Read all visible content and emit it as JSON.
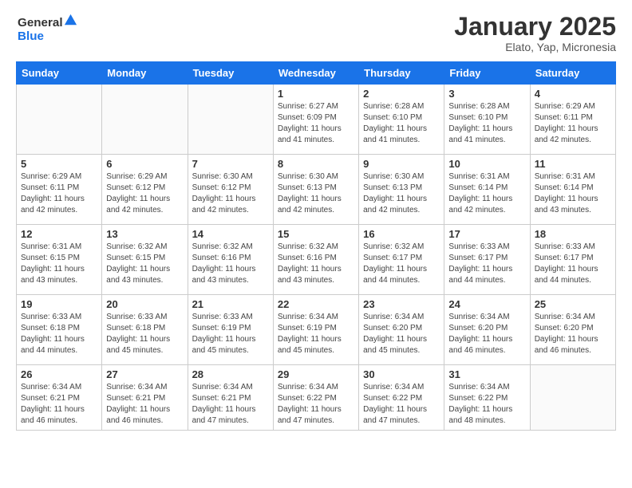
{
  "header": {
    "logo_general": "General",
    "logo_blue": "Blue",
    "month": "January 2025",
    "location": "Elato, Yap, Micronesia"
  },
  "weekdays": [
    "Sunday",
    "Monday",
    "Tuesday",
    "Wednesday",
    "Thursday",
    "Friday",
    "Saturday"
  ],
  "weeks": [
    [
      {
        "day": "",
        "info": ""
      },
      {
        "day": "",
        "info": ""
      },
      {
        "day": "",
        "info": ""
      },
      {
        "day": "1",
        "info": "Sunrise: 6:27 AM\nSunset: 6:09 PM\nDaylight: 11 hours and 41 minutes."
      },
      {
        "day": "2",
        "info": "Sunrise: 6:28 AM\nSunset: 6:10 PM\nDaylight: 11 hours and 41 minutes."
      },
      {
        "day": "3",
        "info": "Sunrise: 6:28 AM\nSunset: 6:10 PM\nDaylight: 11 hours and 41 minutes."
      },
      {
        "day": "4",
        "info": "Sunrise: 6:29 AM\nSunset: 6:11 PM\nDaylight: 11 hours and 42 minutes."
      }
    ],
    [
      {
        "day": "5",
        "info": "Sunrise: 6:29 AM\nSunset: 6:11 PM\nDaylight: 11 hours and 42 minutes."
      },
      {
        "day": "6",
        "info": "Sunrise: 6:29 AM\nSunset: 6:12 PM\nDaylight: 11 hours and 42 minutes."
      },
      {
        "day": "7",
        "info": "Sunrise: 6:30 AM\nSunset: 6:12 PM\nDaylight: 11 hours and 42 minutes."
      },
      {
        "day": "8",
        "info": "Sunrise: 6:30 AM\nSunset: 6:13 PM\nDaylight: 11 hours and 42 minutes."
      },
      {
        "day": "9",
        "info": "Sunrise: 6:30 AM\nSunset: 6:13 PM\nDaylight: 11 hours and 42 minutes."
      },
      {
        "day": "10",
        "info": "Sunrise: 6:31 AM\nSunset: 6:14 PM\nDaylight: 11 hours and 42 minutes."
      },
      {
        "day": "11",
        "info": "Sunrise: 6:31 AM\nSunset: 6:14 PM\nDaylight: 11 hours and 43 minutes."
      }
    ],
    [
      {
        "day": "12",
        "info": "Sunrise: 6:31 AM\nSunset: 6:15 PM\nDaylight: 11 hours and 43 minutes."
      },
      {
        "day": "13",
        "info": "Sunrise: 6:32 AM\nSunset: 6:15 PM\nDaylight: 11 hours and 43 minutes."
      },
      {
        "day": "14",
        "info": "Sunrise: 6:32 AM\nSunset: 6:16 PM\nDaylight: 11 hours and 43 minutes."
      },
      {
        "day": "15",
        "info": "Sunrise: 6:32 AM\nSunset: 6:16 PM\nDaylight: 11 hours and 43 minutes."
      },
      {
        "day": "16",
        "info": "Sunrise: 6:32 AM\nSunset: 6:17 PM\nDaylight: 11 hours and 44 minutes."
      },
      {
        "day": "17",
        "info": "Sunrise: 6:33 AM\nSunset: 6:17 PM\nDaylight: 11 hours and 44 minutes."
      },
      {
        "day": "18",
        "info": "Sunrise: 6:33 AM\nSunset: 6:17 PM\nDaylight: 11 hours and 44 minutes."
      }
    ],
    [
      {
        "day": "19",
        "info": "Sunrise: 6:33 AM\nSunset: 6:18 PM\nDaylight: 11 hours and 44 minutes."
      },
      {
        "day": "20",
        "info": "Sunrise: 6:33 AM\nSunset: 6:18 PM\nDaylight: 11 hours and 45 minutes."
      },
      {
        "day": "21",
        "info": "Sunrise: 6:33 AM\nSunset: 6:19 PM\nDaylight: 11 hours and 45 minutes."
      },
      {
        "day": "22",
        "info": "Sunrise: 6:34 AM\nSunset: 6:19 PM\nDaylight: 11 hours and 45 minutes."
      },
      {
        "day": "23",
        "info": "Sunrise: 6:34 AM\nSunset: 6:20 PM\nDaylight: 11 hours and 45 minutes."
      },
      {
        "day": "24",
        "info": "Sunrise: 6:34 AM\nSunset: 6:20 PM\nDaylight: 11 hours and 46 minutes."
      },
      {
        "day": "25",
        "info": "Sunrise: 6:34 AM\nSunset: 6:20 PM\nDaylight: 11 hours and 46 minutes."
      }
    ],
    [
      {
        "day": "26",
        "info": "Sunrise: 6:34 AM\nSunset: 6:21 PM\nDaylight: 11 hours and 46 minutes."
      },
      {
        "day": "27",
        "info": "Sunrise: 6:34 AM\nSunset: 6:21 PM\nDaylight: 11 hours and 46 minutes."
      },
      {
        "day": "28",
        "info": "Sunrise: 6:34 AM\nSunset: 6:21 PM\nDaylight: 11 hours and 47 minutes."
      },
      {
        "day": "29",
        "info": "Sunrise: 6:34 AM\nSunset: 6:22 PM\nDaylight: 11 hours and 47 minutes."
      },
      {
        "day": "30",
        "info": "Sunrise: 6:34 AM\nSunset: 6:22 PM\nDaylight: 11 hours and 47 minutes."
      },
      {
        "day": "31",
        "info": "Sunrise: 6:34 AM\nSunset: 6:22 PM\nDaylight: 11 hours and 48 minutes."
      },
      {
        "day": "",
        "info": ""
      }
    ]
  ]
}
